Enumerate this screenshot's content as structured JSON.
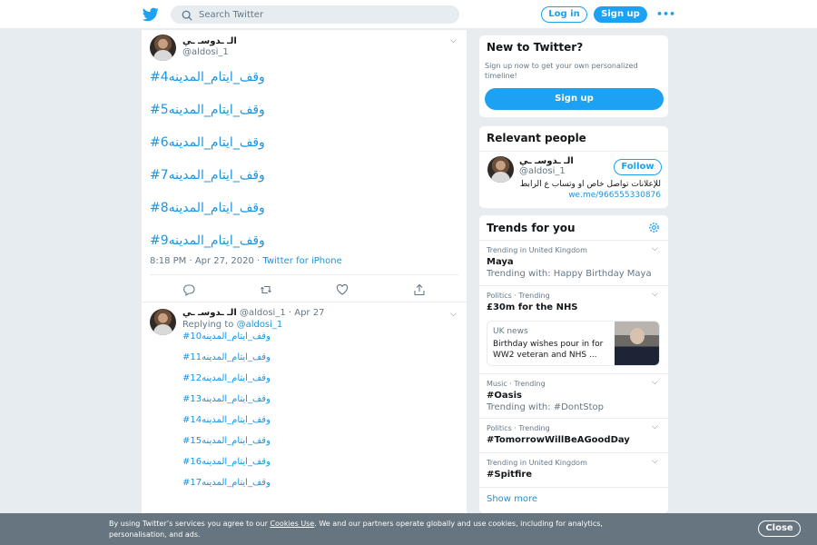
{
  "header": {
    "search_placeholder": "Search Twitter",
    "login_label": "Log in",
    "signup_label": "Sign up",
    "more_label": "•••"
  },
  "tweet1": {
    "name": "الـ ـدوسـ ـي",
    "handle": "@aldosi_1",
    "lines": [
      "#وقف_ايتام_المدينه4",
      "#وقف_ايتام_المدينه5",
      "#وقف_ايتام_المدينه6",
      "#وقف_ايتام_المدينه7",
      "#وقف_ايتام_المدينه8",
      "#وقف_ايتام_المدينه9"
    ],
    "timestamp": "8:18 PM · Apr 27, 2020 · ",
    "source": "Twitter for iPhone"
  },
  "tweet2": {
    "name": "الـ ـدوسـ ـي",
    "handle": "@aldosi_1",
    "date": "· Apr 27",
    "replying_prefix": "Replying to ",
    "replying_handle": "@aldosi_1",
    "lines": [
      "#وقف_ايتام_المدينه10",
      "#وقف_ايتام_المدينه11",
      "#وقف_ايتام_المدينه12",
      "#وقف_ايتام_المدينه13",
      "#وقف_ايتام_المدينه14",
      "#وقف_ايتام_المدينه15",
      "#وقف_ايتام_المدينه16",
      "#وقف_ايتام_المدينه17"
    ]
  },
  "new_to_twitter": {
    "title": "New to Twitter?",
    "subtitle": "Sign up now to get your own personalized timeline!",
    "button": "Sign up"
  },
  "relevant": {
    "title": "Relevant people",
    "name": "الـ ـدوسـ ـي",
    "handle": "@aldosi_1",
    "follow": "Follow",
    "bio": "للإعلانات تواصل خاص او وتساب ع الرابط",
    "link": "we.me/966555330876"
  },
  "trends": {
    "title": "Trends for you",
    "items": [
      {
        "context": "Trending in United Kingdom",
        "name": "Maya",
        "with": "Trending with: Happy Birthday Maya"
      },
      {
        "context": "Politics · Trending",
        "name": "£30m for the NHS"
      },
      {
        "context": "Music · Trending",
        "name": "#Oasis",
        "with": "Trending with: #DontStop"
      },
      {
        "context": "Politics · Trending",
        "name": "#TomorrowWillBeAGoodDay"
      },
      {
        "context": "Trending in United Kingdom",
        "name": "#Spitfire"
      }
    ],
    "news": {
      "source": "UK news",
      "headline": "Birthday wishes pour in for WW2 veteran and NHS ..."
    },
    "show_more": "Show more"
  },
  "cookie": {
    "prefix": "By using Twitter’s services you agree to our ",
    "link": "Cookies Use",
    "suffix": ". We and our partners operate globally and use cookies, including for analytics, personalisation, and ads.",
    "close": "Close"
  },
  "colors": {
    "accent": "#1da1f2",
    "link": "#1b95e0",
    "cookie_bg": "#66757f"
  }
}
